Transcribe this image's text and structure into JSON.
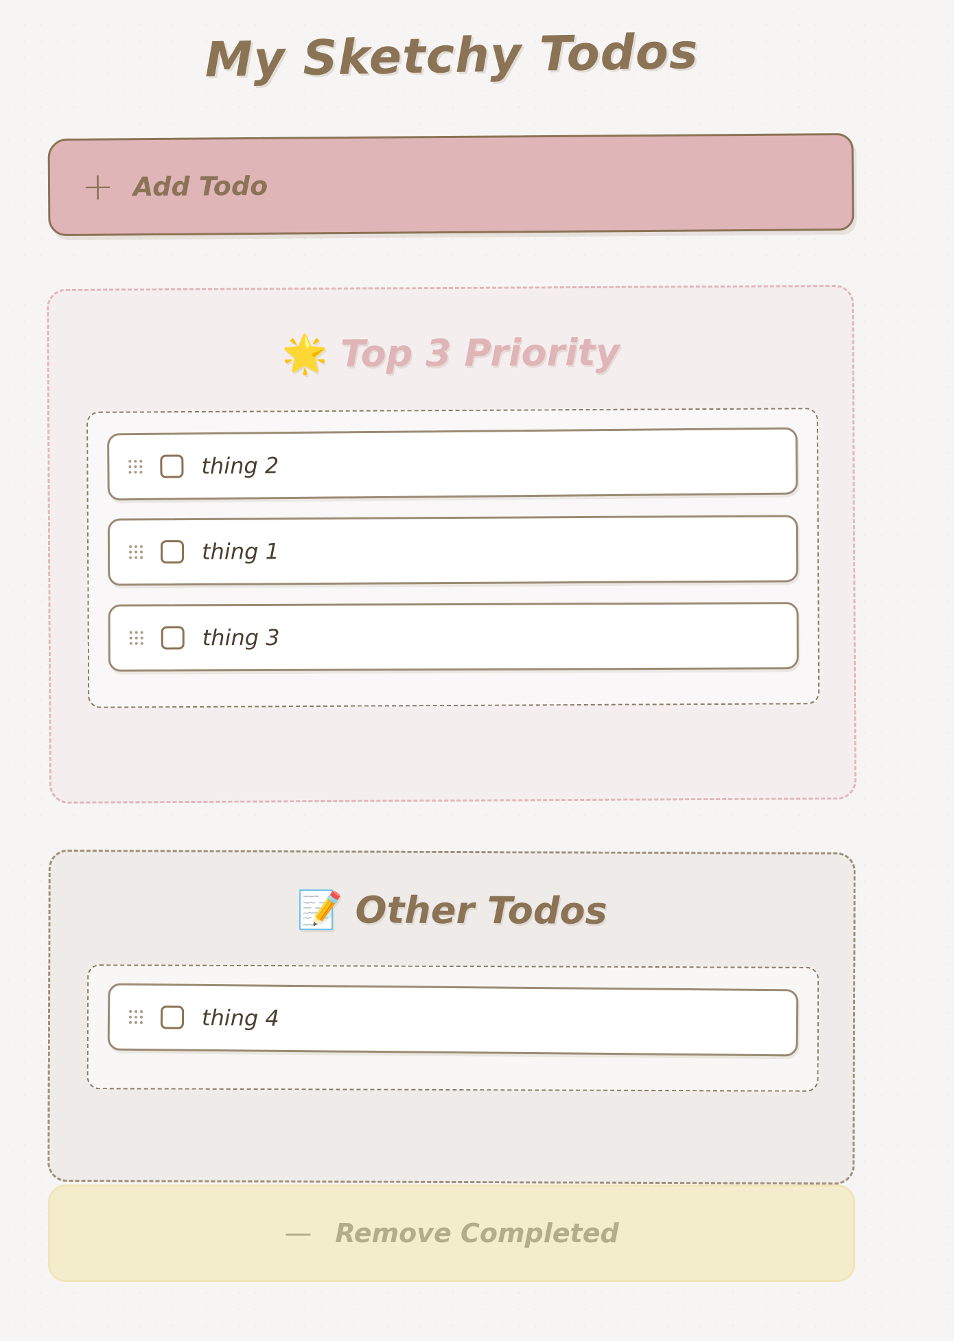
{
  "page": {
    "title": "My Sketchy Todos"
  },
  "add_todo": {
    "icon": "+",
    "label": "Add Todo"
  },
  "sections": {
    "priority": {
      "emoji": "🌟",
      "title": "Top 3 Priority",
      "items": [
        {
          "text": "thing 2",
          "checked": false
        },
        {
          "text": "thing 1",
          "checked": false
        },
        {
          "text": "thing 3",
          "checked": false
        }
      ]
    },
    "other": {
      "emoji": "📝",
      "title": "Other Todos",
      "items": [
        {
          "text": "thing 4",
          "checked": false
        }
      ]
    }
  },
  "remove_completed": {
    "icon": "—",
    "label": "Remove Completed"
  },
  "colors": {
    "accent": "#8b7355",
    "add_button_bg": "#e0b5b8",
    "priority_title": "#e0b5b8",
    "remove_button_bg": "#f4edcc"
  }
}
